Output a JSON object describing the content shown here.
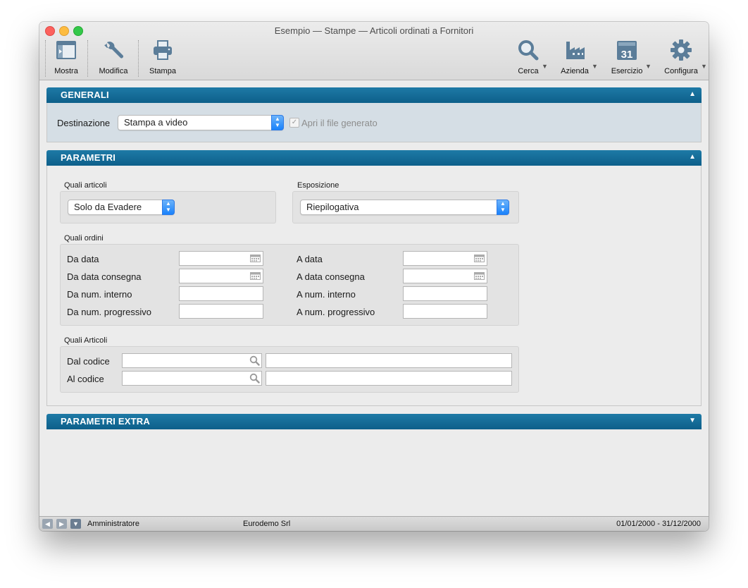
{
  "window": {
    "title": "Esempio — Stampe — Articoli ordinati a Fornitori"
  },
  "toolbar": {
    "mostra": "Mostra",
    "modifica": "Modifica",
    "stampa": "Stampa",
    "cerca": "Cerca",
    "azienda": "Azienda",
    "esercizio": "Esercizio",
    "esercizio_day": "31",
    "configura": "Configura"
  },
  "generali": {
    "title": "GENERALI",
    "destinazione_label": "Destinazione",
    "destinazione_value": "Stampa a video",
    "apri_file_label": "Apri il file generato",
    "apri_file_checked": true
  },
  "parametri": {
    "title": "PARAMETRI",
    "quali_articoli_label": "Quali articoli",
    "quali_articoli_value": "Solo da Evadere",
    "esposizione_label": "Esposizione",
    "esposizione_value": "Riepilogativa",
    "quali_ordini_label": "Quali ordini",
    "da_data": "Da data",
    "a_data": "A data",
    "da_data_consegna": "Da data consegna",
    "a_data_consegna": "A data consegna",
    "da_num_interno": "Da num. interno",
    "a_num_interno": "A num. interno",
    "da_num_progressivo": "Da num. progressivo",
    "a_num_progressivo": "A num. progressivo",
    "quali_articoli2_label": "Quali Articoli",
    "dal_codice": "Dal codice",
    "al_codice": "Al codice"
  },
  "parametri_extra": {
    "title": "PARAMETRI EXTRA"
  },
  "statusbar": {
    "user": "Amministratore",
    "company": "Eurodemo Srl",
    "period": "01/01/2000 - 31/12/2000"
  },
  "colors": {
    "section_header": "#0d5f8a",
    "popup_accent": "#1a82fb"
  }
}
